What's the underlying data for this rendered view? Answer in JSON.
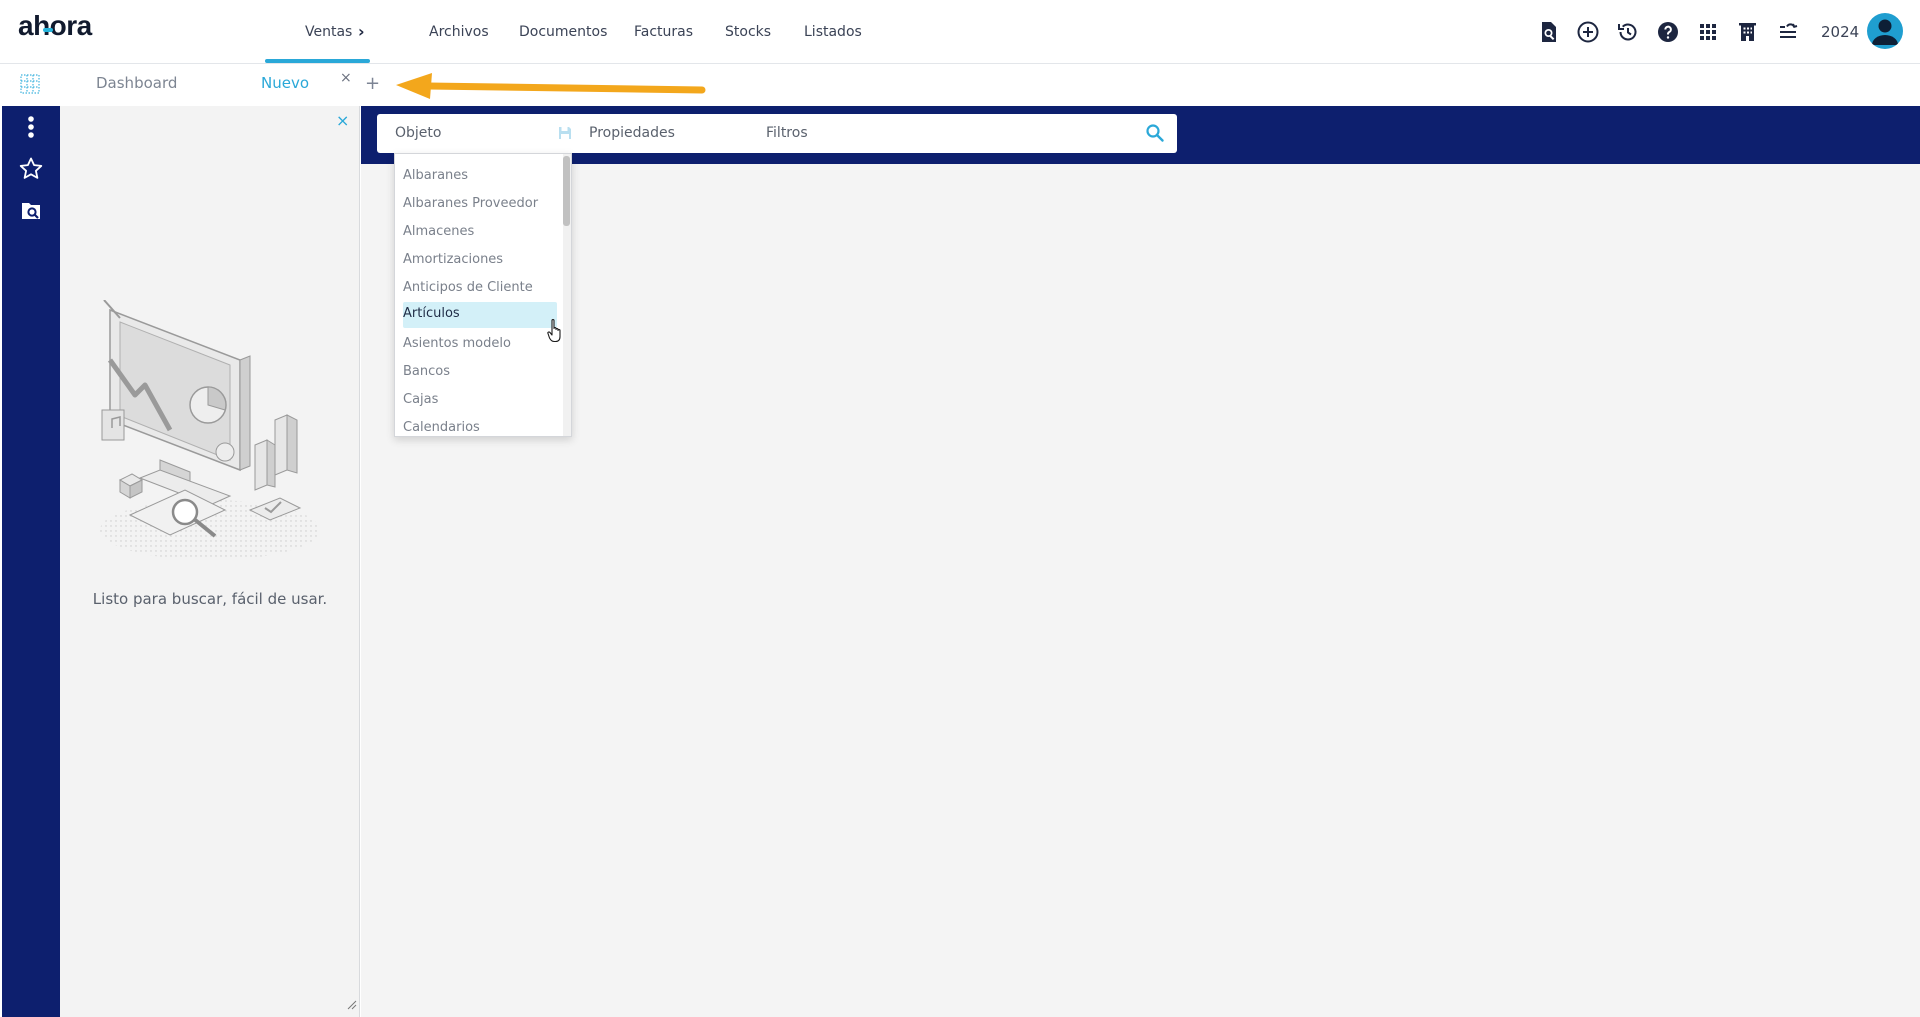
{
  "app": {
    "logo": "ahora"
  },
  "nav": {
    "items": [
      {
        "label": "Ventas"
      },
      {
        "label": "Archivos"
      },
      {
        "label": "Documentos"
      },
      {
        "label": "Facturas"
      },
      {
        "label": "Stocks"
      },
      {
        "label": "Listados"
      }
    ],
    "chevron": "›"
  },
  "toolbar": {
    "icons": [
      "search-document-icon",
      "add-circle-icon",
      "history-icon",
      "help-icon",
      "apps-grid-icon",
      "building-icon",
      "tasks-list-icon"
    ],
    "year": "2024"
  },
  "tabs": {
    "items": [
      {
        "label": "Dashboard",
        "active": false
      },
      {
        "label": "Nuevo",
        "active": true
      }
    ],
    "close_glyph": "×",
    "add_glyph": "+"
  },
  "panel": {
    "close_glyph": "×",
    "message": "Listo para buscar, fácil de usar."
  },
  "search": {
    "object_label": "Objeto",
    "properties_label": "Propiedades",
    "filters_label": "Filtros"
  },
  "dropdown": {
    "items": [
      {
        "label": "Albaranes"
      },
      {
        "label": "Albaranes Proveedor"
      },
      {
        "label": "Almacenes"
      },
      {
        "label": "Amortizaciones"
      },
      {
        "label": "Anticipos de Cliente"
      },
      {
        "label": "Artículos",
        "selected": true
      },
      {
        "label": "Asientos modelo"
      },
      {
        "label": "Bancos"
      },
      {
        "label": "Cajas"
      },
      {
        "label": "Calendarios"
      }
    ]
  },
  "colors": {
    "brand_navy": "#0d1f6e",
    "accent_cyan": "#2aa8d8",
    "arrow_orange": "#f3a71c",
    "selection_bg": "#d3f0f8"
  }
}
